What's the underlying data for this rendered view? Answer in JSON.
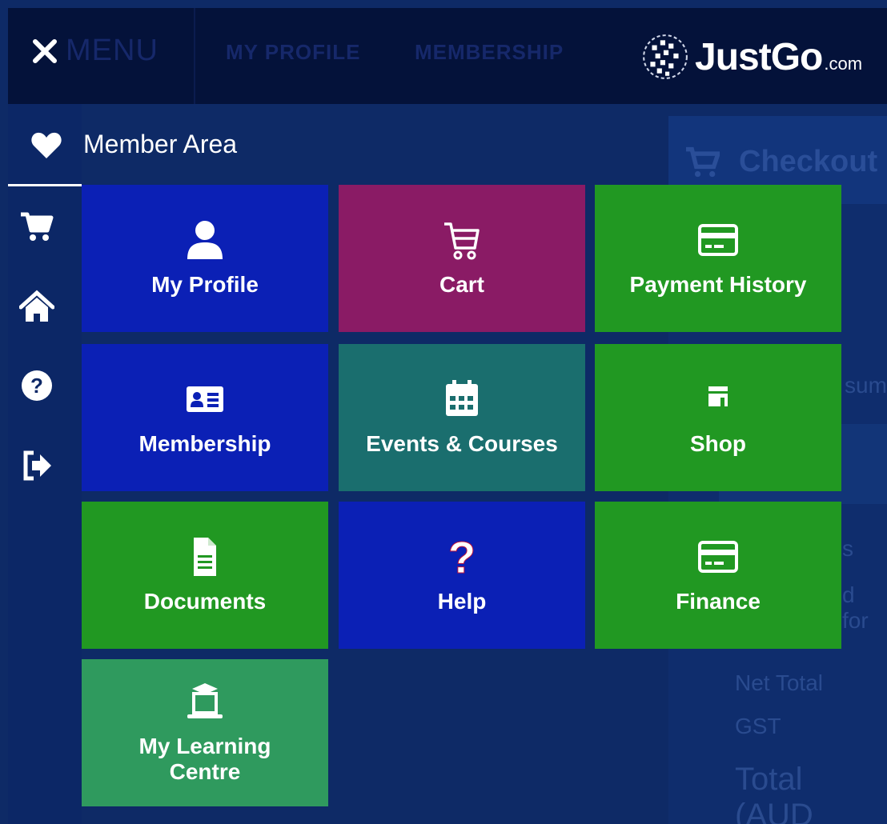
{
  "topbar": {
    "close_label": "✕",
    "menu_ghost": "MENU",
    "nav_items": [
      "MY PROFILE",
      "MEMBERSHIP"
    ],
    "logo": {
      "brand": "JustGo",
      "suffix": ".com"
    }
  },
  "background": {
    "checkout_title": "Checkout",
    "summary_fragment": "sum",
    "s_fragment": "s",
    "d_for_fragment": "d for",
    "net_total": "Net Total",
    "gst": "GST",
    "total": "Total (AUD"
  },
  "member_area": {
    "title": "Member Area"
  },
  "sidebar": {
    "icons": [
      "cart-icon",
      "home-icon",
      "help-icon",
      "sign-out-icon"
    ]
  },
  "tiles": [
    {
      "label": "My Profile",
      "icon": "user-icon",
      "color": "#0b20b5"
    },
    {
      "label": "Cart",
      "icon": "cart-icon",
      "color": "#8a1b65"
    },
    {
      "label": "Payment History",
      "icon": "credit-card-icon",
      "color": "#219822"
    },
    {
      "label": "Membership",
      "icon": "id-card-icon",
      "color": "#0b20b5"
    },
    {
      "label": "Events & Courses",
      "icon": "calendar-icon",
      "color": "#1a6e6e"
    },
    {
      "label": "Shop",
      "icon": "store-icon",
      "color": "#219822"
    },
    {
      "label": "Documents",
      "icon": "document-icon",
      "color": "#219822"
    },
    {
      "label": "Help",
      "icon": "question-icon",
      "color": "#0b20b5"
    },
    {
      "label": "Finance",
      "icon": "credit-card-icon",
      "color": "#219822"
    },
    {
      "label": "My Learning Centre",
      "icon": "learning-icon",
      "color": "#2f9a5e"
    }
  ]
}
